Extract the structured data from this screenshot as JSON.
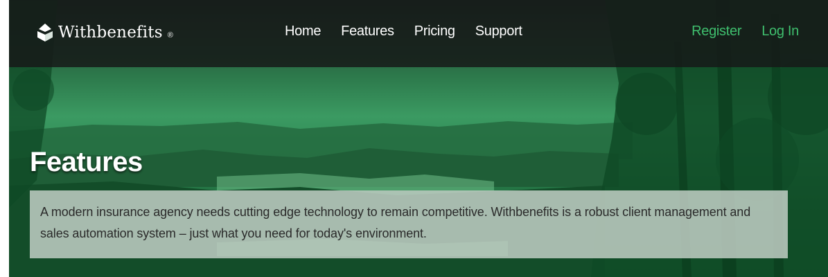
{
  "brand": {
    "name": "Withbenefits",
    "registered_mark": "®",
    "logo_icon": "stacked-leaves-logo-icon"
  },
  "nav": {
    "items": [
      {
        "label": "Home"
      },
      {
        "label": "Features"
      },
      {
        "label": "Pricing"
      },
      {
        "label": "Support"
      }
    ]
  },
  "auth": {
    "register_label": "Register",
    "login_label": "Log In"
  },
  "hero": {
    "title": "Features",
    "intro": "A modern insurance agency needs cutting edge technology to remain competitive. Withbenefits is a robust client management and sales automation system – just what you need for today's environment."
  },
  "colors": {
    "topbar": "#161a18",
    "accent_green": "#3fbf6e",
    "hero_tint": "#2d8a55",
    "nav_text": "#ffffff"
  }
}
